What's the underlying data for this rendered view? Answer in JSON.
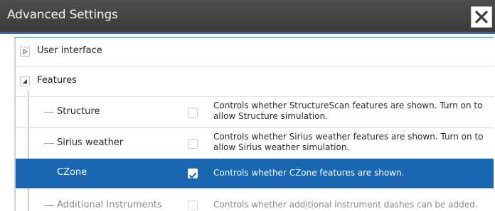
{
  "window": {
    "title": "Advanced Settings",
    "close_icon": "close-icon"
  },
  "tree": {
    "groups": [
      {
        "label": "User interface",
        "expanded": false,
        "icon": "expand-arrow-icon"
      },
      {
        "label": "Features",
        "expanded": true,
        "icon": "collapse-arrow-icon"
      }
    ],
    "items": [
      {
        "label": "Structure",
        "checked": false,
        "description": "Controls whether StructureScan features are shown. Turn on to allow Structure simulation."
      },
      {
        "label": "Sirius weather",
        "checked": false,
        "description": "Controls whether Sirius weather features are shown. Turn on to allow Sirius weather simulation."
      },
      {
        "label": "CZone",
        "checked": true,
        "selected": true,
        "description": "Controls whether CZone features are shown."
      },
      {
        "label": "Additional Instruments",
        "checked": false,
        "description": "Controls whether additional instrument dashes can be added."
      }
    ]
  },
  "colors": {
    "titlebar": "#444444",
    "accent": "#2f6fa8",
    "selection": "#1a66b0"
  }
}
